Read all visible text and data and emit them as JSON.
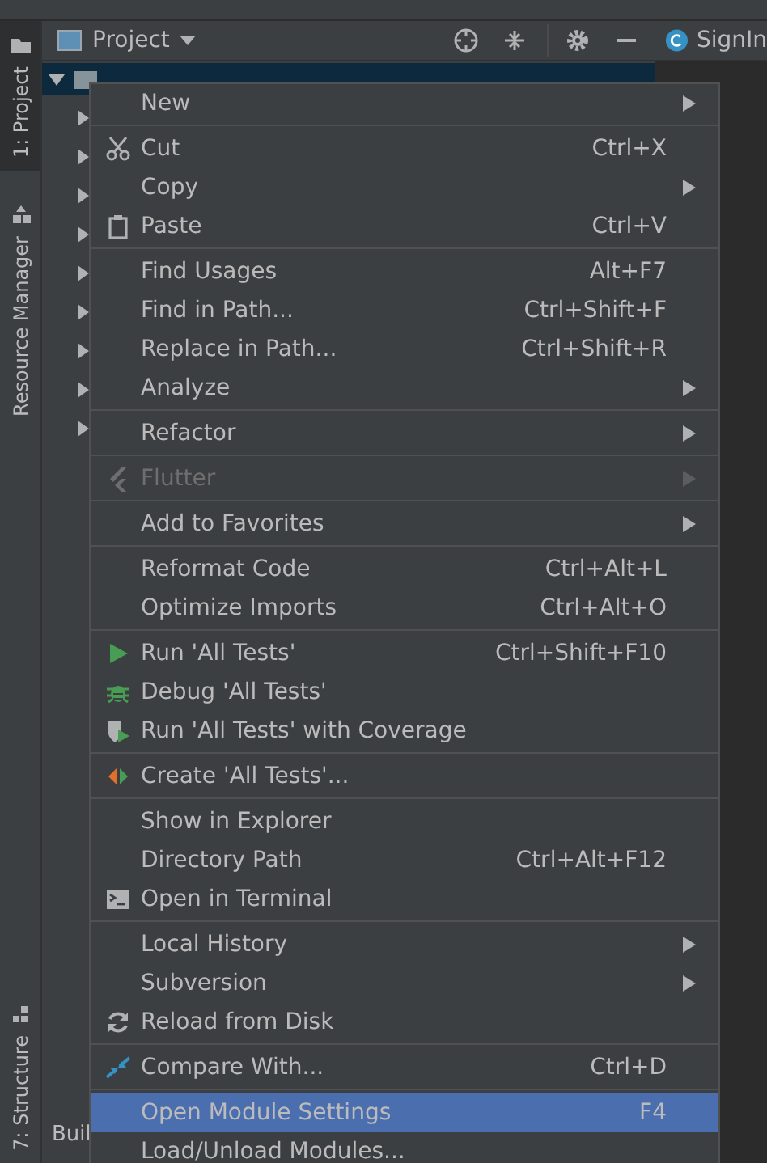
{
  "tool_strip": {
    "tabs": [
      {
        "label": "1: Project",
        "selected": true
      },
      {
        "label": "Resource Manager",
        "selected": false
      },
      {
        "label": "7: Structure",
        "selected": false
      }
    ],
    "bottom_tab": "Buil"
  },
  "project_panel": {
    "title": "Project",
    "tree": [
      {
        "expanded": true,
        "selected": true
      },
      {
        "expanded": false,
        "selected": false
      },
      {
        "expanded": false,
        "selected": false
      },
      {
        "expanded": false,
        "selected": false
      },
      {
        "expanded": false,
        "selected": false
      },
      {
        "expanded": false,
        "selected": false
      },
      {
        "expanded": false,
        "selected": false
      },
      {
        "expanded": false,
        "selected": false
      },
      {
        "expanded": false,
        "selected": false
      },
      {
        "expanded": false,
        "selected": false
      }
    ]
  },
  "editor": {
    "tab": "SignIn"
  },
  "context_menu": {
    "groups": [
      [
        {
          "label": "New",
          "submenu": true,
          "kind": "plain",
          "disabled": false,
          "selected": false
        }
      ],
      [
        {
          "label": "Cut",
          "shortcut": "Ctrl+X",
          "submenu": false,
          "kind": "cut",
          "disabled": false,
          "selected": false
        },
        {
          "label": "Copy",
          "submenu": true,
          "kind": "plain",
          "disabled": false,
          "selected": false
        },
        {
          "label": "Paste",
          "shortcut": "Ctrl+V",
          "submenu": false,
          "kind": "paste",
          "disabled": false,
          "selected": false
        }
      ],
      [
        {
          "label": "Find Usages",
          "shortcut": "Alt+F7",
          "submenu": false,
          "kind": "plain",
          "disabled": false,
          "selected": false
        },
        {
          "label": "Find in Path...",
          "shortcut": "Ctrl+Shift+F",
          "submenu": false,
          "kind": "plain",
          "disabled": false,
          "selected": false
        },
        {
          "label": "Replace in Path...",
          "shortcut": "Ctrl+Shift+R",
          "submenu": false,
          "kind": "plain",
          "disabled": false,
          "selected": false
        },
        {
          "label": "Analyze",
          "submenu": true,
          "kind": "plain",
          "disabled": false,
          "selected": false
        }
      ],
      [
        {
          "label": "Refactor",
          "submenu": true,
          "kind": "plain",
          "disabled": false,
          "selected": false
        }
      ],
      [
        {
          "label": "Flutter",
          "submenu": true,
          "kind": "flutter",
          "disabled": true,
          "selected": false
        }
      ],
      [
        {
          "label": "Add to Favorites",
          "submenu": true,
          "kind": "plain",
          "disabled": false,
          "selected": false
        }
      ],
      [
        {
          "label": "Reformat Code",
          "shortcut": "Ctrl+Alt+L",
          "submenu": false,
          "kind": "plain",
          "disabled": false,
          "selected": false
        },
        {
          "label": "Optimize Imports",
          "shortcut": "Ctrl+Alt+O",
          "submenu": false,
          "kind": "plain",
          "disabled": false,
          "selected": false
        }
      ],
      [
        {
          "label": "Run 'All Tests'",
          "shortcut": "Ctrl+Shift+F10",
          "submenu": false,
          "kind": "run",
          "disabled": false,
          "selected": false
        },
        {
          "label": "Debug 'All Tests'",
          "submenu": false,
          "kind": "debug",
          "disabled": false,
          "selected": false
        },
        {
          "label": "Run 'All Tests' with Coverage",
          "submenu": false,
          "kind": "coverage",
          "disabled": false,
          "selected": false
        }
      ],
      [
        {
          "label": "Create 'All Tests'...",
          "submenu": false,
          "kind": "create",
          "disabled": false,
          "selected": false
        }
      ],
      [
        {
          "label": "Show in Explorer",
          "submenu": false,
          "kind": "plain",
          "disabled": false,
          "selected": false
        },
        {
          "label": "Directory Path",
          "shortcut": "Ctrl+Alt+F12",
          "submenu": false,
          "kind": "plain",
          "disabled": false,
          "selected": false
        },
        {
          "label": "Open in Terminal",
          "submenu": false,
          "kind": "terminal",
          "disabled": false,
          "selected": false
        }
      ],
      [
        {
          "label": "Local History",
          "submenu": true,
          "kind": "plain",
          "disabled": false,
          "selected": false
        },
        {
          "label": "Subversion",
          "submenu": true,
          "kind": "plain",
          "disabled": false,
          "selected": false
        },
        {
          "label": "Reload from Disk",
          "submenu": false,
          "kind": "reload",
          "disabled": false,
          "selected": false
        }
      ],
      [
        {
          "label": "Compare With...",
          "shortcut": "Ctrl+D",
          "submenu": false,
          "kind": "compare",
          "disabled": false,
          "selected": false
        }
      ],
      [
        {
          "label": "Open Module Settings",
          "shortcut": "F4",
          "submenu": false,
          "kind": "plain",
          "disabled": false,
          "selected": true
        },
        {
          "label": "Load/Unload Modules...",
          "submenu": false,
          "kind": "plain",
          "disabled": false,
          "selected": false
        }
      ]
    ]
  }
}
